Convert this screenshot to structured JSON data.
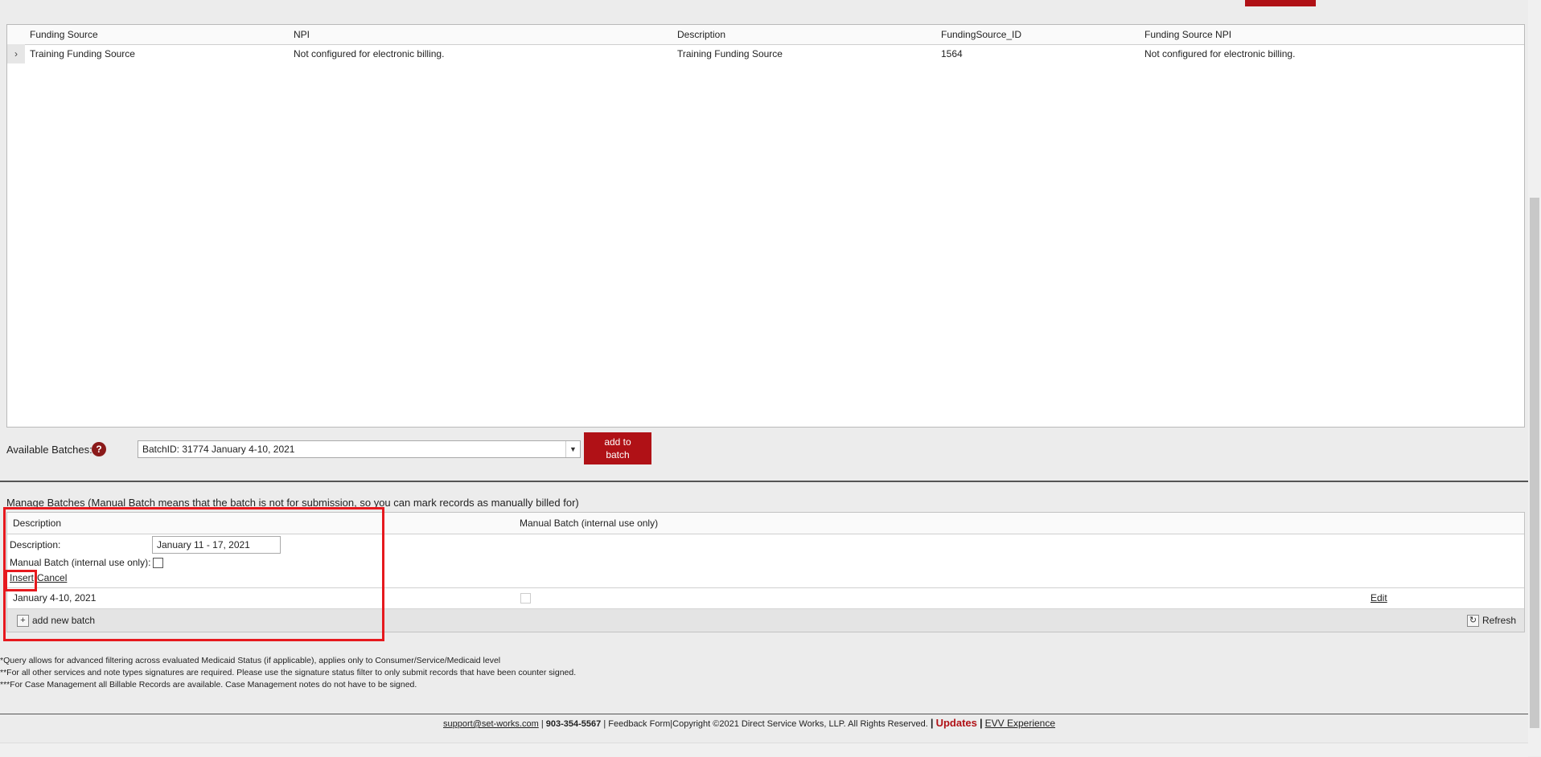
{
  "funding_grid": {
    "columns": [
      "Funding Source",
      "NPI",
      "Description",
      "FundingSource_ID",
      "Funding Source NPI"
    ],
    "rows": [
      {
        "funding_source": "Training Funding Source",
        "npi": "Not configured for electronic billing.",
        "description": "Training Funding Source",
        "funding_source_id": "1564",
        "funding_source_npi": "Not configured for electronic billing."
      }
    ]
  },
  "available_batches": {
    "label": "Available Batches:",
    "help_icon": "?",
    "selected": "BatchID: 31774 January 4-10, 2021",
    "add_button": "add to batch"
  },
  "manage": {
    "title": "Manage Batches (Manual Batch means that the batch is not for submission, so you can mark records as manually billed for)",
    "columns": [
      "Description",
      "Manual Batch (internal use only)"
    ],
    "form": {
      "description_label": "Description:",
      "description_value": "January 11 - 17, 2021",
      "manual_label": "Manual Batch (internal use only):",
      "insert": "Insert",
      "cancel": "Cancel"
    },
    "rows": [
      {
        "description": "January 4-10, 2021",
        "edit": "Edit"
      }
    ],
    "add_new": "add new batch",
    "refresh": "Refresh"
  },
  "notes": [
    "*Query allows for advanced filtering across evaluated Medicaid Status (if applicable), applies only to Consumer/Service/Medicaid level",
    "**For all other services and note types signatures are required. Please use the signature status filter to only submit records that have been counter signed.",
    "***For Case Management all Billable Records are available. Case Management notes do not have to be signed."
  ],
  "footer": {
    "email": "support@set-works.com",
    "sep1": "|",
    "phone": "903-354-5567",
    "sep2": "|",
    "feedback": "Feedback Form",
    "sep3": "|",
    "copyright": "Copyright ©2021 Direct Service Works, LLP. All Rights Reserved.",
    "sep4": "|",
    "updates": "Updates",
    "sep5": "|",
    "evv": "EVV Experience"
  },
  "colors": {
    "brand_red": "#b01116",
    "highlight_red": "#e6191e"
  }
}
